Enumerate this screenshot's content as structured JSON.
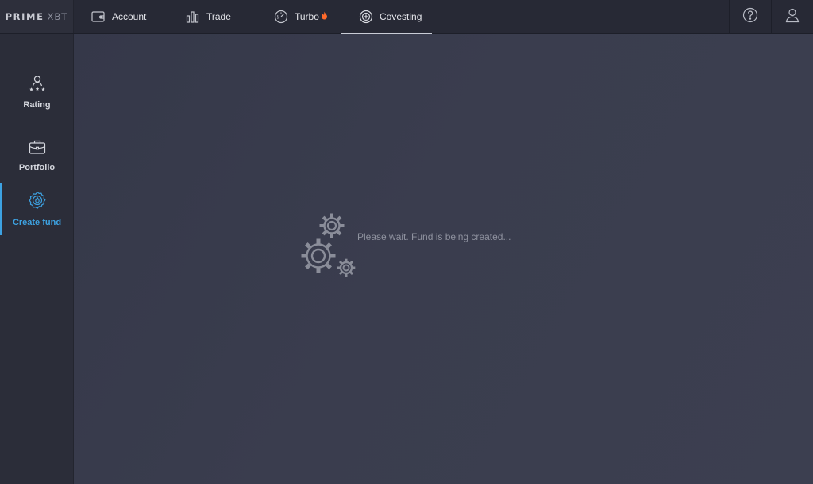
{
  "brand": {
    "primary": "PRIME",
    "secondary": "XBT"
  },
  "nav": [
    {
      "label": "Account",
      "icon": "wallet-icon"
    },
    {
      "label": "Trade",
      "icon": "bar-chart-icon"
    },
    {
      "label": "Turbo",
      "icon": "turbo-icon",
      "badge": "fire-icon"
    },
    {
      "label": "Covesting",
      "icon": "covesting-icon",
      "active": true
    }
  ],
  "top_right": {
    "help_icon": "help-icon",
    "profile_icon": "user-icon"
  },
  "sidebar": [
    {
      "label": "Rating",
      "icon": "rating-icon"
    },
    {
      "label": "Portfolio",
      "icon": "briefcase-icon"
    },
    {
      "label": "Create fund",
      "icon": "create-fund-icon",
      "active": true
    }
  ],
  "main": {
    "status_text": "Please wait. Fund is being created...",
    "icon": "gears-icon"
  },
  "colors": {
    "accent": "#3da2e2",
    "background": "#2a2c38",
    "main_bg": "#383b4c",
    "muted_text": "#8f929f"
  }
}
